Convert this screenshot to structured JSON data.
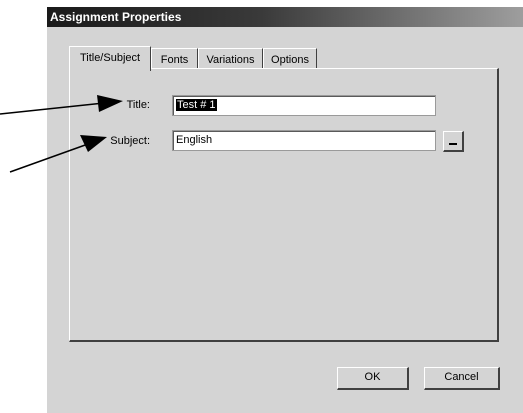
{
  "window": {
    "title": "Assignment Properties"
  },
  "tabs": [
    {
      "label": "Title/Subject",
      "active": true
    },
    {
      "label": "Fonts",
      "active": false
    },
    {
      "label": "Variations",
      "active": false
    },
    {
      "label": "Options",
      "active": false
    }
  ],
  "form": {
    "title_label": "Title:",
    "title_value": "Test # 1",
    "subject_label": "Subject:",
    "subject_value": "English"
  },
  "buttons": {
    "ok_label": "OK",
    "cancel_label": "Cancel"
  },
  "annotations": {
    "arrow_color": "#000000"
  },
  "colors": {
    "dialog_face": "#d4d4d4",
    "titlebar_start": "#1a1a1a",
    "titlebar_end": "#9e9e9e"
  }
}
